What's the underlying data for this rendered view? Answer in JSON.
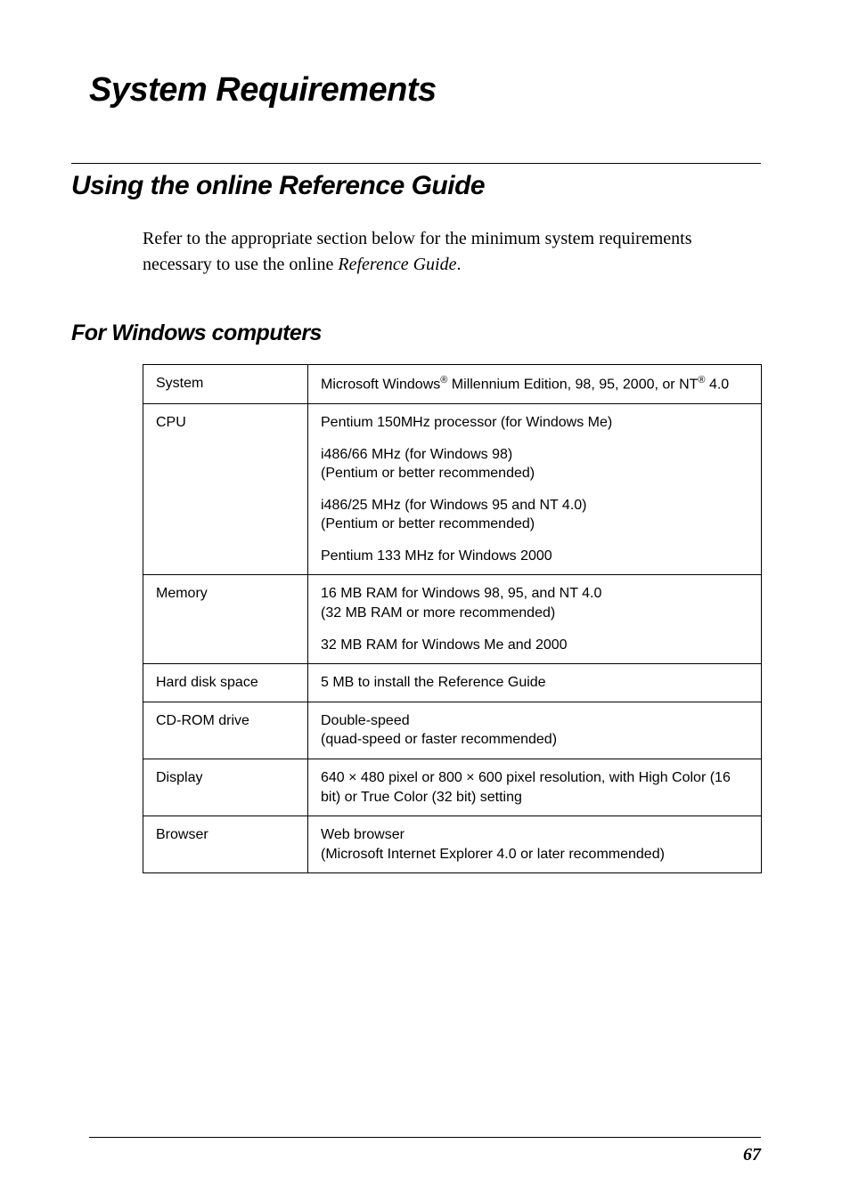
{
  "page": {
    "title": "System Requirements",
    "section_heading": "Using the online Reference Guide",
    "intro_prefix": "Refer to the appropriate section below for the minimum system requirements necessary to use the online ",
    "intro_italic": "Reference Guide",
    "intro_suffix": ".",
    "subsection_heading": "For Windows computers",
    "page_number": "67"
  },
  "table": {
    "rows": [
      {
        "label": "System",
        "value_html": "Microsoft Windows<span class=\"sup\">®</span> Millennium Edition, 98, 95, 2000, or NT<span class=\"sup\">®</span> 4.0"
      },
      {
        "label": "CPU",
        "value_blocks": [
          "Pentium 150MHz processor (for Windows Me)",
          "i486/66 MHz (for Windows 98)\n(Pentium or better recommended)",
          "i486/25 MHz (for Windows 95 and NT 4.0)\n(Pentium or better recommended)",
          "Pentium 133 MHz for Windows 2000"
        ]
      },
      {
        "label": "Memory",
        "value_blocks": [
          "16 MB RAM for Windows  98, 95, and NT 4.0\n(32 MB RAM or more recommended)",
          "32 MB RAM for Windows Me and 2000"
        ]
      },
      {
        "label": "Hard disk space",
        "value": "5  MB to install the Reference Guide"
      },
      {
        "label": "CD-ROM drive",
        "value": "Double-speed\n(quad-speed or faster recommended)"
      },
      {
        "label": "Display",
        "value": "640 × 480 pixel or 800 × 600 pixel resolution, with High Color (16 bit) or True Color (32 bit) setting"
      },
      {
        "label": "Browser",
        "value": "Web browser\n(Microsoft Internet Explorer 4.0 or later recommended)"
      }
    ]
  }
}
